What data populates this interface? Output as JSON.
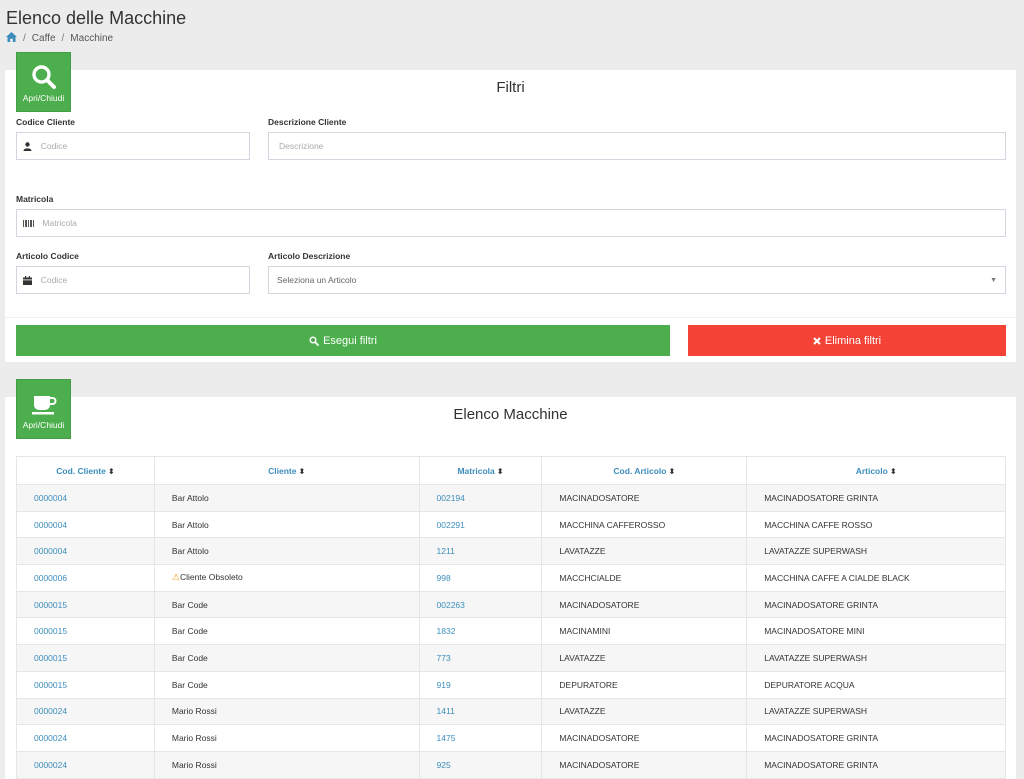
{
  "page": {
    "title": "Elenco delle Macchine",
    "breadcrumb": [
      "Caffe",
      "Macchine"
    ]
  },
  "filters": {
    "toggle_label": "Apri/Chiudi",
    "title": "Filtri",
    "codice_cliente": {
      "label": "Codice Cliente",
      "placeholder": "Codice"
    },
    "descrizione_cliente": {
      "label": "Descrizione Cliente",
      "placeholder": "Descrizione"
    },
    "matricola": {
      "label": "Matricola",
      "placeholder": "Matricola"
    },
    "articolo_codice": {
      "label": "Articolo Codice",
      "placeholder": "Codice"
    },
    "articolo_descrizione": {
      "label": "Articolo Descrizione",
      "selected": "Seleziona un Articolo"
    },
    "apply_label": "Esegui filtri",
    "clear_label": "Elimina filtri"
  },
  "list": {
    "toggle_label": "Apri/Chiudi",
    "title": "Elenco Macchine",
    "columns": [
      "Cod. Cliente",
      "Cliente",
      "Matricola",
      "Cod. Articolo",
      "Articolo"
    ],
    "rows": [
      {
        "cod_cliente": "0000004",
        "cliente": "Bar Attolo",
        "warning": false,
        "matricola": "002194",
        "cod_articolo": "MACINADOSATORE",
        "articolo": "MACINADOSATORE GRINTA"
      },
      {
        "cod_cliente": "0000004",
        "cliente": "Bar Attolo",
        "warning": false,
        "matricola": "002291",
        "cod_articolo": "MACCHINA CAFFEROSSO",
        "articolo": "MACCHINA CAFFE ROSSO"
      },
      {
        "cod_cliente": "0000004",
        "cliente": "Bar Attolo",
        "warning": false,
        "matricola": "1211",
        "cod_articolo": "LAVATAZZE",
        "articolo": "LAVATAZZE SUPERWASH"
      },
      {
        "cod_cliente": "0000006",
        "cliente": "Cliente Obsoleto",
        "warning": true,
        "matricola": "998",
        "cod_articolo": "MACCHCIALDE",
        "articolo": "MACCHINA CAFFE A CIALDE BLACK"
      },
      {
        "cod_cliente": "0000015",
        "cliente": "Bar Code",
        "warning": false,
        "matricola": "002263",
        "cod_articolo": "MACINADOSATORE",
        "articolo": "MACINADOSATORE GRINTA"
      },
      {
        "cod_cliente": "0000015",
        "cliente": "Bar Code",
        "warning": false,
        "matricola": "1832",
        "cod_articolo": "MACINAMINI",
        "articolo": "MACINADOSATORE MINI"
      },
      {
        "cod_cliente": "0000015",
        "cliente": "Bar Code",
        "warning": false,
        "matricola": "773",
        "cod_articolo": "LAVATAZZE",
        "articolo": "LAVATAZZE SUPERWASH"
      },
      {
        "cod_cliente": "0000015",
        "cliente": "Bar Code",
        "warning": false,
        "matricola": "919",
        "cod_articolo": "DEPURATORE",
        "articolo": "DEPURATORE ACQUA"
      },
      {
        "cod_cliente": "0000024",
        "cliente": "Mario Rossi",
        "warning": false,
        "matricola": "1411",
        "cod_articolo": "LAVATAZZE",
        "articolo": "LAVATAZZE SUPERWASH"
      },
      {
        "cod_cliente": "0000024",
        "cliente": "Mario Rossi",
        "warning": false,
        "matricola": "1475",
        "cod_articolo": "MACINADOSATORE",
        "articolo": "MACINADOSATORE GRINTA"
      },
      {
        "cod_cliente": "0000024",
        "cliente": "Mario Rossi",
        "warning": false,
        "matricola": "925",
        "cod_articolo": "MACINADOSATORE",
        "articolo": "MACINADOSATORE GRINTA"
      }
    ]
  },
  "colors": {
    "primary_green": "#4cae4c",
    "danger_red": "#f44336",
    "link_blue": "#3c8dbc",
    "warning_orange": "#f39c12"
  },
  "icons": {
    "toggle_filters": "search-icon",
    "toggle_list": "coffee-cup-icon",
    "breadcrumb_home": "home-icon",
    "sort": "sort-icon"
  }
}
